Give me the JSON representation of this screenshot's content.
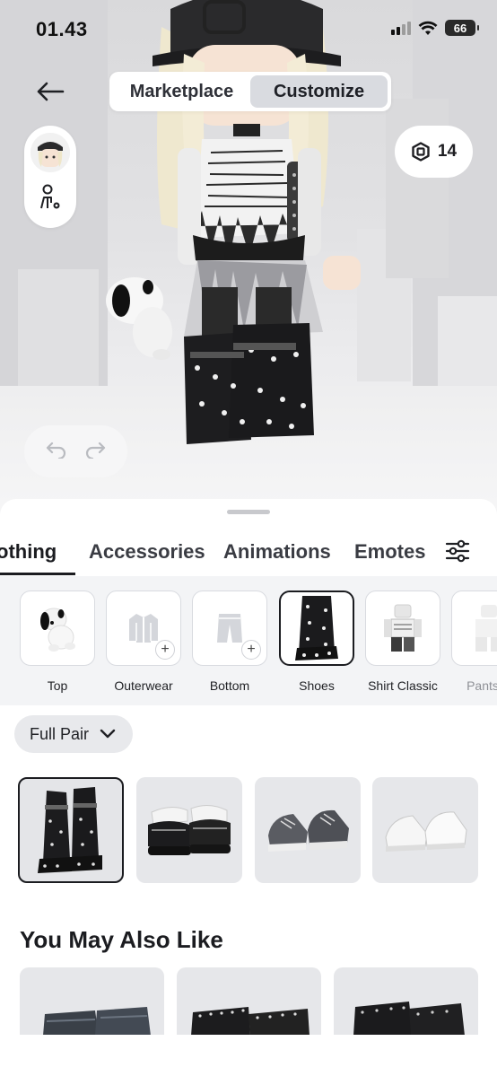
{
  "status_bar": {
    "time": "01.43",
    "battery": "66"
  },
  "top_bar": {
    "segments": [
      {
        "label": "Marketplace",
        "active": false
      },
      {
        "label": "Customize",
        "active": true
      }
    ]
  },
  "robux": {
    "amount": "14"
  },
  "sheet": {
    "tabs": [
      {
        "label": "othing",
        "active": true
      },
      {
        "label": "Accessories",
        "active": false
      },
      {
        "label": "Animations",
        "active": false
      },
      {
        "label": "Emotes",
        "active": false
      }
    ],
    "categories": [
      {
        "label": "Top",
        "icon": "dog-plush-icon",
        "has_add": false,
        "selected": false
      },
      {
        "label": "Outerwear",
        "icon": "jacket-icon",
        "has_add": true,
        "selected": false
      },
      {
        "label": "Bottom",
        "icon": "pants-icon",
        "has_add": true,
        "selected": false
      },
      {
        "label": "Shoes",
        "icon": "fur-boot-icon",
        "has_add": false,
        "selected": true
      },
      {
        "label": "Shirt Classic",
        "icon": "shirt-classic-icon",
        "has_add": false,
        "selected": false
      },
      {
        "label": "Pants C",
        "icon": "pants-classic-icon",
        "has_add": false,
        "selected": false
      }
    ],
    "filter": {
      "label": "Full Pair"
    },
    "items": [
      {
        "name": "fur-leg-warmers",
        "selected": true
      },
      {
        "name": "platform-mary-janes",
        "selected": false
      },
      {
        "name": "grey-sneakers",
        "selected": false
      },
      {
        "name": "white-sneakers",
        "selected": false
      }
    ],
    "recommend_title": "You May Also Like"
  },
  "colors": {
    "accent": "#1b1c20",
    "sheet_bg": "#f3f4f6",
    "tile_bg": "#e6e7ea"
  }
}
